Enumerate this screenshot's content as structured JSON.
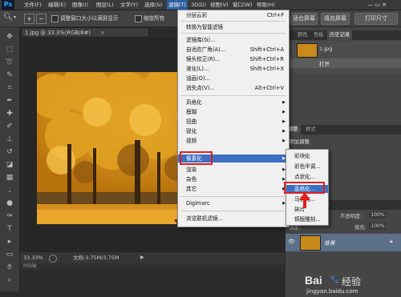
{
  "app": {
    "logo": "Ps"
  },
  "menubar": {
    "items": [
      "文件(F)",
      "编辑(E)",
      "图像(I)",
      "图层(L)",
      "文字(Y)",
      "选择(S)",
      "滤镜(T)",
      "3D(D)",
      "视图(V)",
      "窗口(W)",
      "帮助(H)"
    ],
    "active_index": 6
  },
  "options": {
    "resize_windows": "调整窗口大小以满屏显示",
    "zoom_all": "缩放所有",
    "fit_screen": "适合屏幕",
    "fill_screen": "填充屏幕",
    "print_size": "打印尺寸"
  },
  "document": {
    "tab_label": "1.jpg @ 33.3%(RGB/8#)",
    "tab_close": "×",
    "zoom": "33.33%",
    "doc_size": "文档:3.75M/3.75M",
    "timeline_label": "时间轴"
  },
  "filter_menu": {
    "items": [
      {
        "label": "分层云彩",
        "shortcut": "Ctrl+F"
      },
      {
        "label": "转换为智能滤镜",
        "shortcut": ""
      },
      {
        "label": "滤镜库(G)...",
        "shortcut": ""
      },
      {
        "label": "自适应广角(A)...",
        "shortcut": "Shift+Ctrl+A"
      },
      {
        "label": "镜头校正(R)...",
        "shortcut": "Shift+Ctrl+R"
      },
      {
        "label": "液化(L)...",
        "shortcut": "Shift+Ctrl+X"
      },
      {
        "label": "油画(O)...",
        "shortcut": ""
      },
      {
        "label": "消失点(V)...",
        "shortcut": "Alt+Ctrl+V"
      },
      {
        "label": "风格化",
        "shortcut": ""
      },
      {
        "label": "模糊",
        "shortcut": ""
      },
      {
        "label": "扭曲",
        "shortcut": ""
      },
      {
        "label": "锐化",
        "shortcut": ""
      },
      {
        "label": "视频",
        "shortcut": ""
      },
      {
        "label": "像素化",
        "shortcut": ""
      },
      {
        "label": "渲染",
        "shortcut": ""
      },
      {
        "label": "杂色",
        "shortcut": ""
      },
      {
        "label": "其它",
        "shortcut": ""
      },
      {
        "label": "Digimarc",
        "shortcut": ""
      },
      {
        "label": "浏览联机滤镜...",
        "shortcut": ""
      }
    ],
    "highlighted": "像素化"
  },
  "pixelate_submenu": {
    "items": [
      "彩块化",
      "彩色半调...",
      "点状化...",
      "晶格化...",
      "马赛克...",
      "碎片",
      "铜版雕刻..."
    ],
    "highlighted": "晶格化..."
  },
  "right_panel": {
    "top_tabs": [
      "颜色",
      "色板",
      "历史记录"
    ],
    "history_file": "1.jpg",
    "history_step": "打开",
    "mid_tabs": [
      "调整",
      "样式"
    ],
    "adjust_title": "添加调整",
    "layer_tabs": [
      "图层",
      "通道",
      "路径"
    ],
    "opacity_label": "不透明度:",
    "opacity_value": "100%",
    "fill_label": "填充:",
    "fill_value": "100%",
    "layer_name": "背景",
    "lock_label": "锁定:"
  },
  "watermark": {
    "brand": "Bai",
    "brand_cn": "经验",
    "url": "jingyan.baidu.com"
  },
  "colors": {
    "highlight": "#3b6fc2",
    "annotation": "#e0201c"
  }
}
